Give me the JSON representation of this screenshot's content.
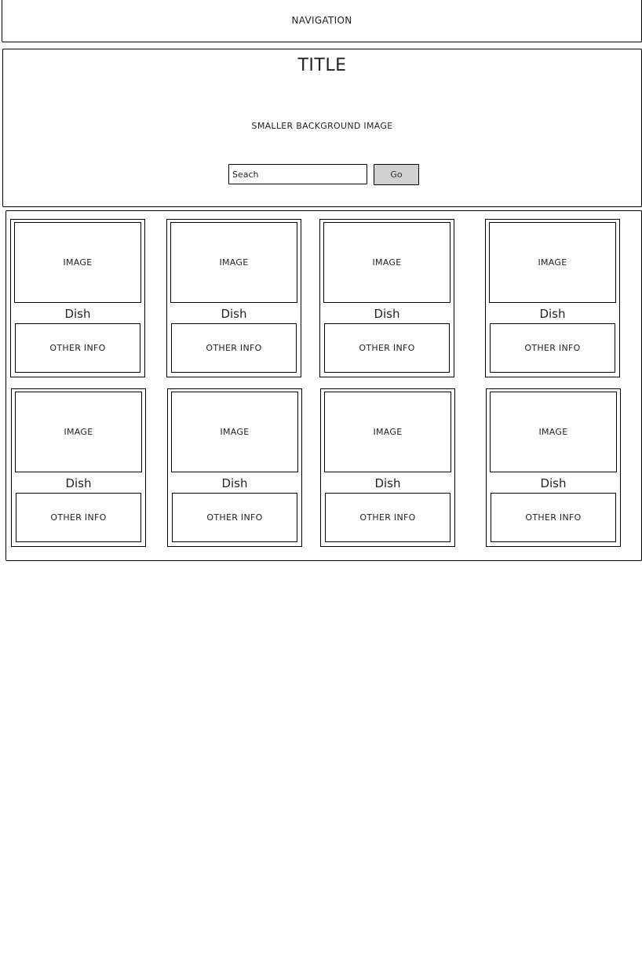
{
  "navigation": {
    "label": "NAVIGATION"
  },
  "hero": {
    "title": "TITLE",
    "background_label": "SMALLER BACKGROUND IMAGE",
    "search": {
      "placeholder": "Seach"
    },
    "go_label": "Go"
  },
  "cards": [
    {
      "image_label": "IMAGE",
      "title": "Dish",
      "info_label": "OTHER INFO"
    },
    {
      "image_label": "IMAGE",
      "title": "Dish",
      "info_label": "OTHER INFO"
    },
    {
      "image_label": "IMAGE",
      "title": "Dish",
      "info_label": "OTHER INFO"
    },
    {
      "image_label": "IMAGE",
      "title": "Dish",
      "info_label": "OTHER INFO"
    },
    {
      "image_label": "IMAGE",
      "title": "Dish",
      "info_label": "OTHER INFO"
    },
    {
      "image_label": "IMAGE",
      "title": "Dish",
      "info_label": "OTHER INFO"
    },
    {
      "image_label": "IMAGE",
      "title": "Dish",
      "info_label": "OTHER INFO"
    },
    {
      "image_label": "IMAGE",
      "title": "Dish",
      "info_label": "OTHER INFO"
    }
  ],
  "colors": {
    "border": "#000000",
    "button_bg": "#d0d0d0",
    "background": "#ffffff"
  }
}
